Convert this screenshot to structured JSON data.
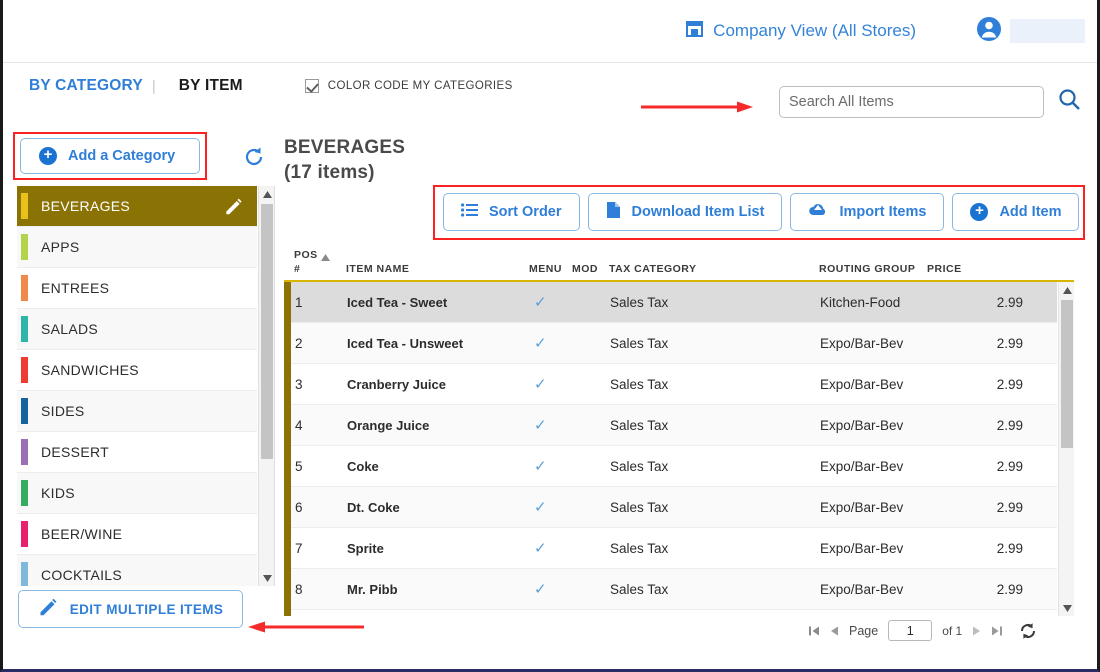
{
  "header": {
    "company_view_label": "Company View (All Stores)",
    "store_icon": "store-icon",
    "avatar_icon": "user-avatar-icon"
  },
  "tabs": {
    "by_category": "BY CATEGORY",
    "divider": "|",
    "by_item": "BY ITEM",
    "color_code_label": "COLOR CODE MY CATEGORIES",
    "color_code_checked": true
  },
  "search": {
    "placeholder": "Search All Items",
    "value": "",
    "icon": "search-icon"
  },
  "sidebar": {
    "add_category_label": "Add a Category",
    "edit_multiple_label": "EDIT MULTIPLE ITEMS",
    "selected_index": 0,
    "categories": [
      {
        "label": "BEVERAGES",
        "color": "#e8c21a",
        "selected": true
      },
      {
        "label": "APPS",
        "color": "#b3d44a",
        "selected": false
      },
      {
        "label": "ENTREES",
        "color": "#f08a4b",
        "selected": false
      },
      {
        "label": "SALADS",
        "color": "#2cb5a8",
        "selected": false
      },
      {
        "label": "SANDWICHES",
        "color": "#ee3b34",
        "selected": false
      },
      {
        "label": "SIDES",
        "color": "#15639e",
        "selected": false
      },
      {
        "label": "DESSERT",
        "color": "#9a6fb5",
        "selected": false
      },
      {
        "label": "KIDS",
        "color": "#35ab5e",
        "selected": false
      },
      {
        "label": "BEER/WINE",
        "color": "#e8216f",
        "selected": false
      },
      {
        "label": "COCKTAILS",
        "color": "#7fb8db",
        "selected": false
      }
    ]
  },
  "main": {
    "title": "BEVERAGES",
    "subtitle": "(17 items)",
    "refresh_icon": "refresh-icon"
  },
  "toolbar": {
    "sort_order_label": "Sort Order",
    "download_label": "Download Item List",
    "import_label": "Import Items",
    "add_item_label": "Add Item"
  },
  "table": {
    "headers": {
      "pos": "POS",
      "pos_num": "#",
      "item_name": "ITEM NAME",
      "menu": "MENU",
      "mod": "MOD",
      "tax_category": "TAX CATEGORY",
      "routing_group": "ROUTING GROUP",
      "price": "PRICE"
    },
    "sort_column": "pos",
    "sort_direction": "asc",
    "rows": [
      {
        "pos": "1",
        "name": "Iced Tea - Sweet",
        "menu": "✓",
        "mod": "",
        "tax": "Sales Tax",
        "route": "Kitchen-Food",
        "price": "2.99",
        "highlighted": true
      },
      {
        "pos": "2",
        "name": "Iced Tea - Unsweet",
        "menu": "✓",
        "mod": "",
        "tax": "Sales Tax",
        "route": "Expo/Bar-Bev",
        "price": "2.99",
        "highlighted": false
      },
      {
        "pos": "3",
        "name": "Cranberry Juice",
        "menu": "✓",
        "mod": "",
        "tax": "Sales Tax",
        "route": "Expo/Bar-Bev",
        "price": "2.99",
        "highlighted": false
      },
      {
        "pos": "4",
        "name": "Orange Juice",
        "menu": "✓",
        "mod": "",
        "tax": "Sales Tax",
        "route": "Expo/Bar-Bev",
        "price": "2.99",
        "highlighted": false
      },
      {
        "pos": "5",
        "name": "Coke",
        "menu": "✓",
        "mod": "",
        "tax": "Sales Tax",
        "route": "Expo/Bar-Bev",
        "price": "2.99",
        "highlighted": false
      },
      {
        "pos": "6",
        "name": "Dt. Coke",
        "menu": "✓",
        "mod": "",
        "tax": "Sales Tax",
        "route": "Expo/Bar-Bev",
        "price": "2.99",
        "highlighted": false
      },
      {
        "pos": "7",
        "name": "Sprite",
        "menu": "✓",
        "mod": "",
        "tax": "Sales Tax",
        "route": "Expo/Bar-Bev",
        "price": "2.99",
        "highlighted": false
      },
      {
        "pos": "8",
        "name": "Mr. Pibb",
        "menu": "✓",
        "mod": "",
        "tax": "Sales Tax",
        "route": "Expo/Bar-Bev",
        "price": "2.99",
        "highlighted": false
      }
    ]
  },
  "pagination": {
    "page_label": "Page",
    "page_value": "1",
    "of_label": "of 1",
    "first_icon": "first-page-icon",
    "prev_icon": "prev-page-icon",
    "next_icon": "next-page-icon",
    "last_icon": "last-page-icon",
    "refresh_icon": "refresh-icon"
  },
  "colors": {
    "accent_blue": "#2f7ed8",
    "annotation_red": "#fb2222",
    "selected_category_bg": "#8a7304",
    "selected_category_bar": "#e8c21a",
    "table_left_bar": "#8a7304",
    "header_underline": "#d9b400"
  }
}
